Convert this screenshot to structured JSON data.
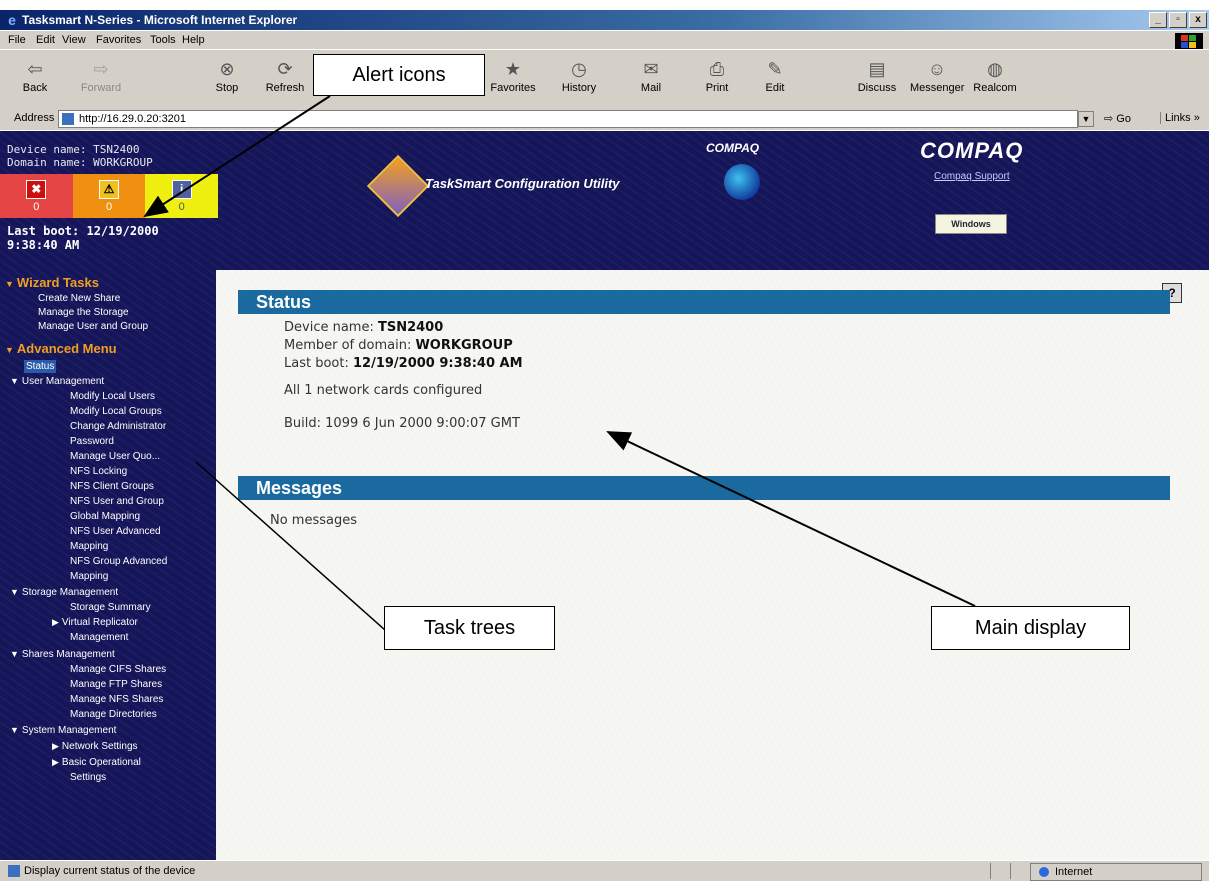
{
  "window": {
    "title": "Tasksmart N-Series - Microsoft Internet Explorer",
    "buttons": [
      "_",
      "▫",
      "x"
    ]
  },
  "menu": [
    "File",
    "Edit",
    "View",
    "Favorites",
    "Tools",
    "Help"
  ],
  "toolbar": [
    {
      "label": "Back",
      "icon": "back-arrow-icon",
      "disabled": false
    },
    {
      "label": "Forward",
      "icon": "forward-arrow-icon",
      "disabled": true
    },
    {
      "label": "Stop",
      "icon": "stop-icon",
      "disabled": false
    },
    {
      "label": "Refresh",
      "icon": "refresh-icon",
      "disabled": false
    },
    {
      "label": "Favorites",
      "icon": "favorites-icon",
      "disabled": false
    },
    {
      "label": "History",
      "icon": "history-icon",
      "disabled": false
    },
    {
      "label": "Mail",
      "icon": "mail-icon",
      "disabled": false
    },
    {
      "label": "Print",
      "icon": "print-icon",
      "disabled": false
    },
    {
      "label": "Edit",
      "icon": "edit-icon",
      "disabled": false
    },
    {
      "label": "Discuss",
      "icon": "discuss-icon",
      "disabled": false
    },
    {
      "label": "Messenger",
      "icon": "messenger-icon",
      "disabled": false
    },
    {
      "label": "Realcom",
      "icon": "realcom-icon",
      "disabled": false
    }
  ],
  "address": {
    "label": "Address",
    "value": "http://16.29.0.20:3201",
    "go": "Go",
    "links": "Links »"
  },
  "header": {
    "device_name": "Device name: TSN2400",
    "domain_name": "Domain name: WORKGROUP",
    "alerts": [
      {
        "type": "error",
        "icon": "error-icon",
        "count": "0"
      },
      {
        "type": "warning",
        "icon": "warning-icon",
        "count": "0"
      },
      {
        "type": "info",
        "icon": "info-icon",
        "count": "0"
      }
    ],
    "last_boot_line1": "Last boot: 12/19/2000",
    "last_boot_line2": "9:38:40 AM",
    "utility_title": "TaskSmart Configuration Utility",
    "compaq_small": "COMPAQ",
    "compaq_big": "COMPAQ",
    "compaq_support": "Compaq Support",
    "windows_badge": "Windows"
  },
  "sidebar": {
    "wizard_header": "Wizard Tasks",
    "wizard_items": [
      "Create New Share",
      "Manage the Storage",
      "Manage User and Group"
    ],
    "advanced_header": "Advanced Menu",
    "status_item": "Status",
    "user_mgmt": "User Management",
    "user_items": [
      "Modify Local Users",
      "Modify Local Groups",
      "Change Administrator",
      "Password",
      "Manage User Quo...",
      "NFS Locking",
      "NFS Client Groups",
      "NFS User and Group",
      "Global Mapping",
      "NFS User Advanced",
      "Mapping",
      "NFS Group Advanced",
      "Mapping"
    ],
    "storage_mgmt": "Storage Management",
    "storage_items": [
      "Storage Summary",
      "Virtual Replicator",
      "Management"
    ],
    "shares_mgmt": "Shares Management",
    "shares_items": [
      "Manage CIFS Shares",
      "Manage FTP Shares",
      "Manage NFS Shares",
      "Manage Directories"
    ],
    "system_mgmt": "System Management",
    "system_items": [
      "Network Settings",
      "Basic Operational",
      "Settings"
    ]
  },
  "main": {
    "status_title": "Status",
    "device_label": "Device name: ",
    "device_value": "TSN2400",
    "domain_label": "Member of domain: ",
    "domain_value": "WORKGROUP",
    "boot_label": "Last boot: ",
    "boot_value": "12/19/2000 9:38:40 AM",
    "network": "All 1 network cards configured",
    "build": "Build: 1099 6 Jun 2000 9:00:07 GMT",
    "messages_title": "Messages",
    "messages_text": "No messages",
    "help": "?"
  },
  "callouts": {
    "alert_icons": "Alert icons",
    "task_trees": "Task trees",
    "main_display": "Main display"
  },
  "statusbar": {
    "text": "Display current status of the device",
    "zone": "Internet"
  }
}
